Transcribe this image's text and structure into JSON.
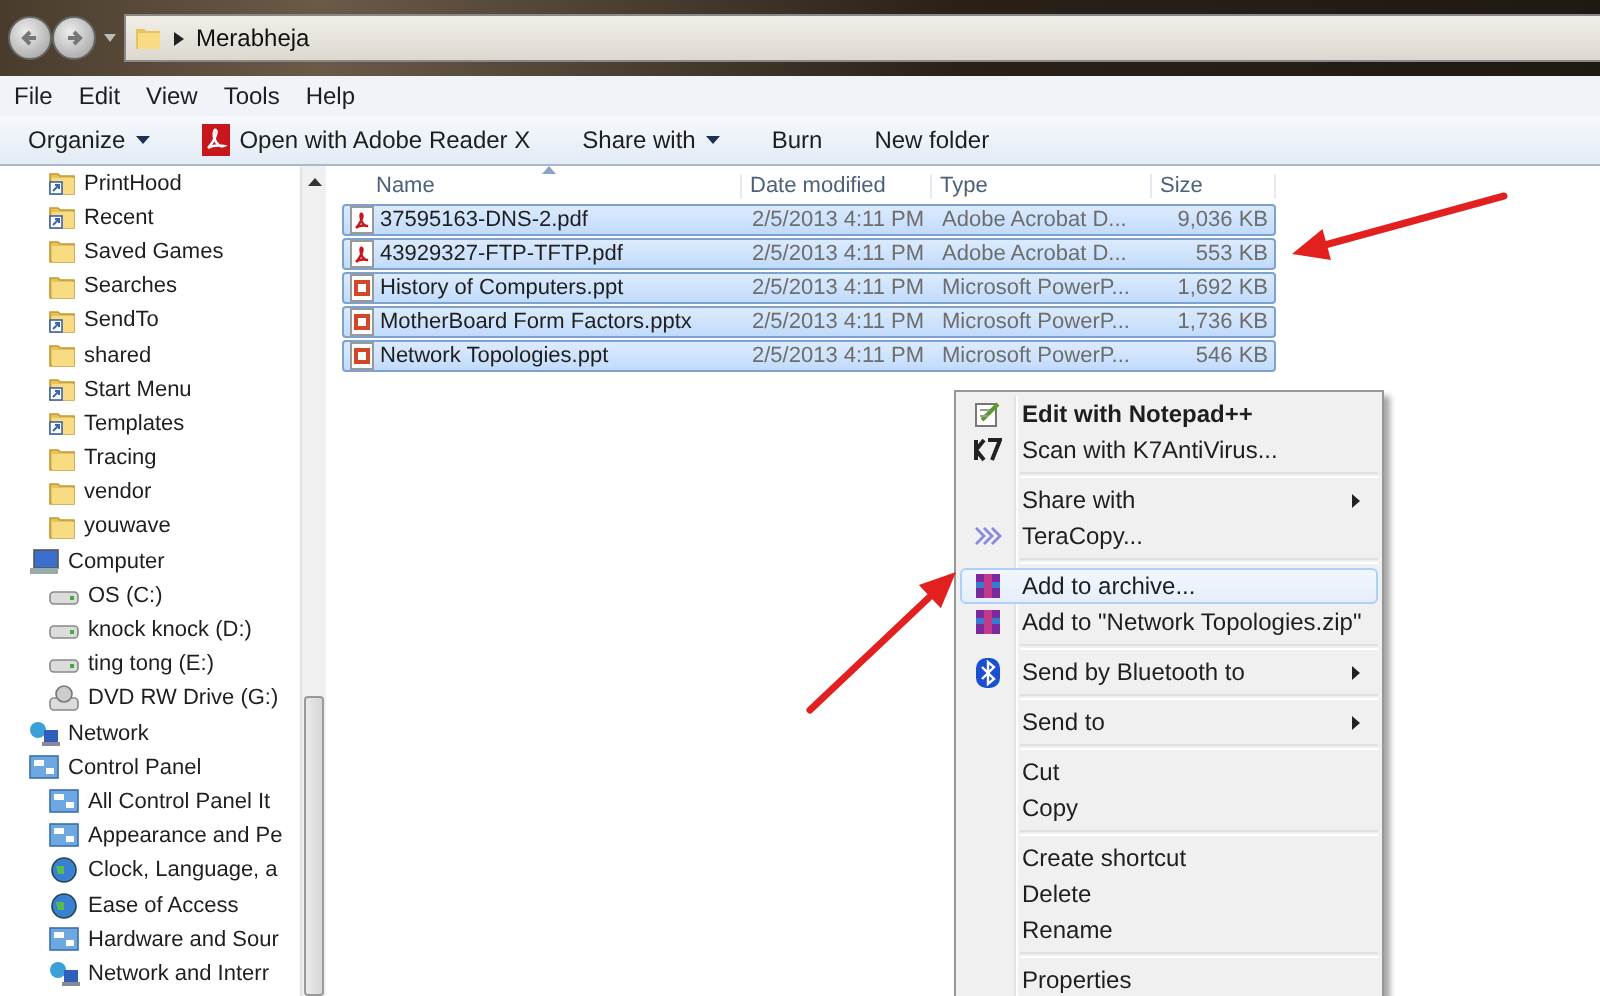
{
  "window": {
    "address": {
      "path": [
        "Merabheja"
      ]
    }
  },
  "menu_bar": [
    "File",
    "Edit",
    "View",
    "Tools",
    "Help"
  ],
  "toolbar": [
    {
      "label": "Organize",
      "kind": "dropdown"
    },
    {
      "label": "Open with Adobe Reader X",
      "kind": "pdf"
    },
    {
      "label": "Share with",
      "kind": "dropdown"
    },
    {
      "label": "Burn",
      "kind": "plain"
    },
    {
      "label": "New folder",
      "kind": "plain"
    }
  ],
  "sidebar": {
    "scrolled_children": [
      {
        "label": "PrintHood",
        "kind": "shortcut"
      },
      {
        "label": "Recent",
        "kind": "shortcut"
      },
      {
        "label": "Saved Games",
        "kind": "folder"
      },
      {
        "label": "Searches",
        "kind": "folder"
      },
      {
        "label": "SendTo",
        "kind": "shortcut"
      },
      {
        "label": "shared",
        "kind": "folder"
      },
      {
        "label": "Start Menu",
        "kind": "shortcut"
      },
      {
        "label": "Templates",
        "kind": "shortcut"
      },
      {
        "label": "Tracing",
        "kind": "folder"
      },
      {
        "label": "vendor",
        "kind": "folder"
      },
      {
        "label": "youwave",
        "kind": "folder"
      }
    ],
    "tree": [
      {
        "label": "Computer",
        "kind": "computer",
        "children": [
          {
            "label": "OS (C:)",
            "kind": "drive"
          },
          {
            "label": "knock knock (D:)",
            "kind": "drive"
          },
          {
            "label": "ting tong (E:)",
            "kind": "drive"
          },
          {
            "label": "DVD RW Drive (G:)",
            "kind": "disc"
          }
        ]
      },
      {
        "label": "Network",
        "kind": "network"
      },
      {
        "label": "Control Panel",
        "kind": "panel",
        "children": [
          {
            "label": "All Control Panel It",
            "kind": "panel"
          },
          {
            "label": "Appearance and Pe",
            "kind": "panel"
          },
          {
            "label": "Clock, Language, a",
            "kind": "globe"
          },
          {
            "label": "Ease of Access",
            "kind": "globe"
          },
          {
            "label": "Hardware and Sour",
            "kind": "panel"
          },
          {
            "label": "Network and Interr",
            "kind": "network"
          }
        ]
      }
    ]
  },
  "file_list": {
    "columns": [
      {
        "label": "Name",
        "sorted": true
      },
      {
        "label": "Date modified",
        "sorted": false
      },
      {
        "label": "Type",
        "sorted": false
      },
      {
        "label": "Size",
        "sorted": false
      }
    ],
    "rows": [
      {
        "name": "37595163-DNS-2.pdf",
        "date": "2/5/2013 4:11 PM",
        "type": "Adobe Acrobat D...",
        "size": "9,036 KB",
        "kind": "pdf",
        "selected": true
      },
      {
        "name": "43929327-FTP-TFTP.pdf",
        "date": "2/5/2013 4:11 PM",
        "type": "Adobe Acrobat D...",
        "size": "553 KB",
        "kind": "pdf",
        "selected": true
      },
      {
        "name": "History of Computers.ppt",
        "date": "2/5/2013 4:11 PM",
        "type": "Microsoft PowerP...",
        "size": "1,692 KB",
        "kind": "ppt",
        "selected": true
      },
      {
        "name": "MotherBoard Form Factors.pptx",
        "date": "2/5/2013 4:11 PM",
        "type": "Microsoft PowerP...",
        "size": "1,736 KB",
        "kind": "ppt",
        "selected": true
      },
      {
        "name": "Network Topologies.ppt",
        "date": "2/5/2013 4:11 PM",
        "type": "Microsoft PowerP...",
        "size": "546 KB",
        "kind": "ppt",
        "selected": true
      }
    ]
  },
  "context_menu": [
    {
      "kind": "notepad",
      "label": "Edit with Notepad++",
      "default": true,
      "submenu": false,
      "selected": false
    },
    {
      "kind": "k7",
      "label": "Scan with K7AntiVirus...",
      "default": false,
      "submenu": false,
      "selected": false
    },
    {
      "kind": "separator"
    },
    {
      "kind": "plain",
      "label": "Share with",
      "default": false,
      "submenu": true,
      "selected": false
    },
    {
      "kind": "teracopy",
      "label": "TeraCopy...",
      "default": false,
      "submenu": false,
      "selected": false
    },
    {
      "kind": "separator"
    },
    {
      "kind": "archive",
      "label": "Add to archive...",
      "default": false,
      "submenu": false,
      "selected": true
    },
    {
      "kind": "archive",
      "label": "Add to \"Network Topologies.zip\"",
      "default": false,
      "submenu": false,
      "selected": false
    },
    {
      "kind": "separator"
    },
    {
      "kind": "bluetooth",
      "label": "Send by Bluetooth to",
      "default": false,
      "submenu": true,
      "selected": false
    },
    {
      "kind": "separator"
    },
    {
      "kind": "plain",
      "label": "Send to",
      "default": false,
      "submenu": true,
      "selected": false
    },
    {
      "kind": "separator"
    },
    {
      "kind": "plain",
      "label": "Cut",
      "default": false,
      "submenu": false,
      "selected": false
    },
    {
      "kind": "plain",
      "label": "Copy",
      "default": false,
      "submenu": false,
      "selected": false
    },
    {
      "kind": "separator"
    },
    {
      "kind": "plain",
      "label": "Create shortcut",
      "default": false,
      "submenu": false,
      "selected": false
    },
    {
      "kind": "plain",
      "label": "Delete",
      "default": false,
      "submenu": false,
      "selected": false
    },
    {
      "kind": "plain",
      "label": "Rename",
      "default": false,
      "submenu": false,
      "selected": false
    },
    {
      "kind": "separator"
    },
    {
      "kind": "plain",
      "label": "Properties",
      "default": false,
      "submenu": false,
      "selected": false
    }
  ],
  "annotations": [
    {
      "kind": "arrow"
    },
    {
      "kind": "arrow"
    }
  ]
}
